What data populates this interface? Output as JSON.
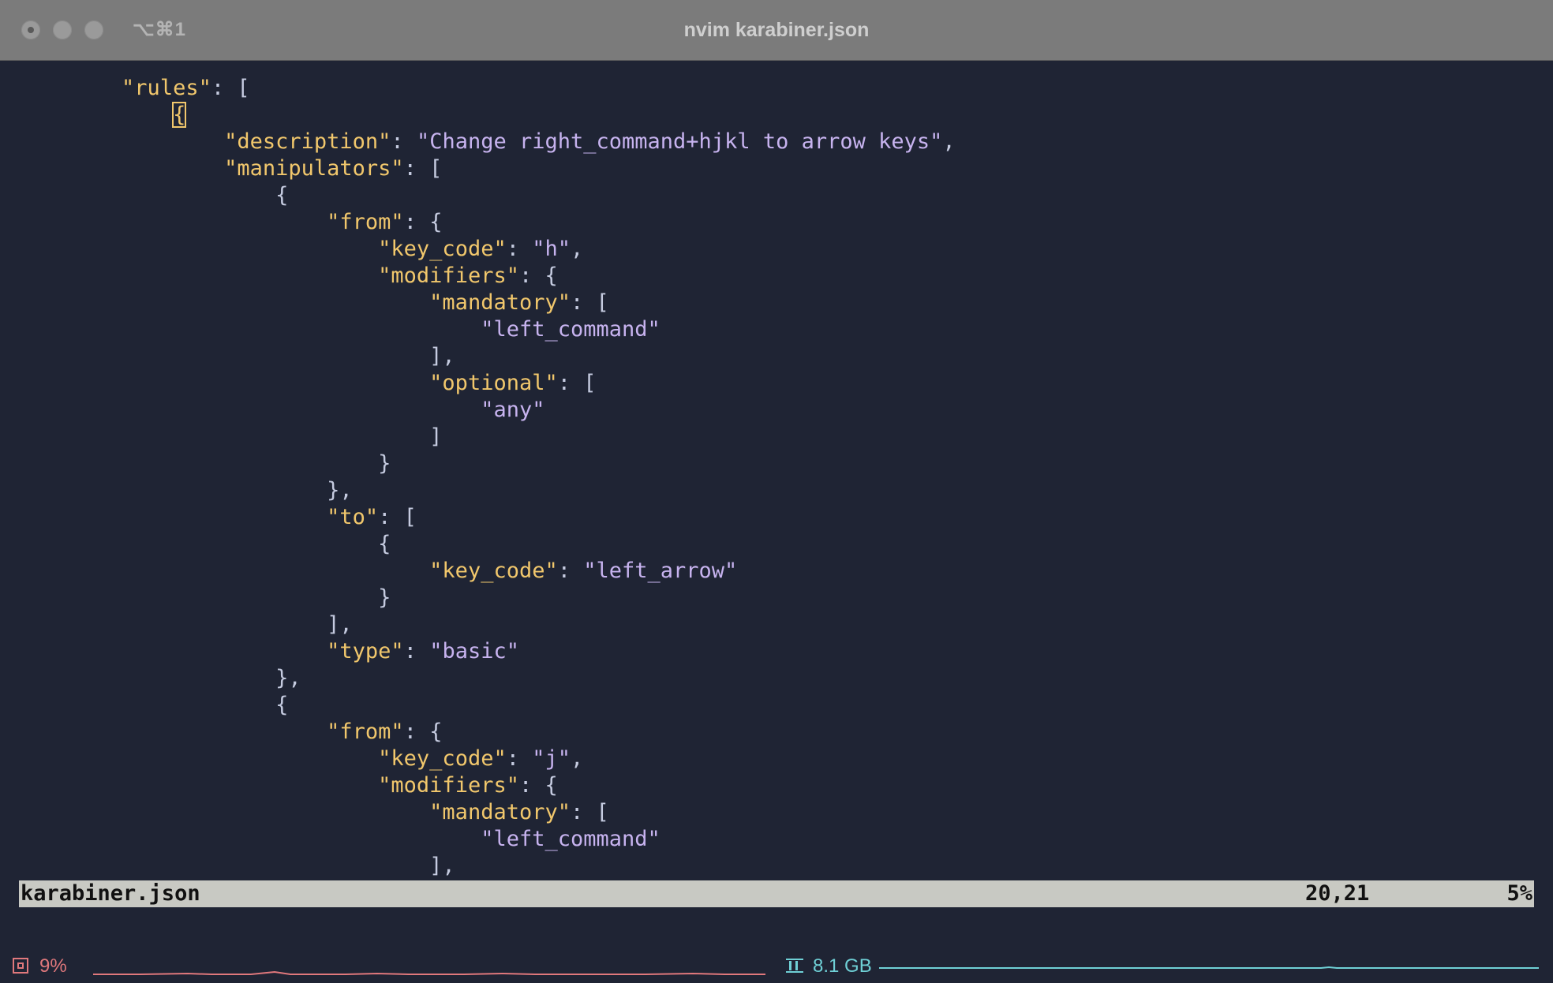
{
  "window": {
    "title": "nvim karabiner.json",
    "shortcut": "⌥⌘1"
  },
  "code_lines": [
    [
      {
        "t": "        ",
        "c": "p"
      },
      {
        "t": "\"rules\"",
        "c": "k"
      },
      {
        "t": ": [",
        "c": "p"
      }
    ],
    [
      {
        "t": "            ",
        "c": "p"
      },
      {
        "t": "{",
        "c": "cursor"
      }
    ],
    [
      {
        "t": "                ",
        "c": "p"
      },
      {
        "t": "\"description\"",
        "c": "k"
      },
      {
        "t": ": ",
        "c": "p"
      },
      {
        "t": "\"Change right_command+hjkl to arrow keys\"",
        "c": "s"
      },
      {
        "t": ",",
        "c": "p"
      }
    ],
    [
      {
        "t": "                ",
        "c": "p"
      },
      {
        "t": "\"manipulators\"",
        "c": "k"
      },
      {
        "t": ": [",
        "c": "p"
      }
    ],
    [
      {
        "t": "                    {",
        "c": "p"
      }
    ],
    [
      {
        "t": "                        ",
        "c": "p"
      },
      {
        "t": "\"from\"",
        "c": "k"
      },
      {
        "t": ": {",
        "c": "p"
      }
    ],
    [
      {
        "t": "                            ",
        "c": "p"
      },
      {
        "t": "\"key_code\"",
        "c": "k"
      },
      {
        "t": ": ",
        "c": "p"
      },
      {
        "t": "\"h\"",
        "c": "s"
      },
      {
        "t": ",",
        "c": "p"
      }
    ],
    [
      {
        "t": "                            ",
        "c": "p"
      },
      {
        "t": "\"modifiers\"",
        "c": "k"
      },
      {
        "t": ": {",
        "c": "p"
      }
    ],
    [
      {
        "t": "                                ",
        "c": "p"
      },
      {
        "t": "\"mandatory\"",
        "c": "k"
      },
      {
        "t": ": [",
        "c": "p"
      }
    ],
    [
      {
        "t": "                                    ",
        "c": "p"
      },
      {
        "t": "\"left_command\"",
        "c": "s"
      }
    ],
    [
      {
        "t": "                                ],",
        "c": "p"
      }
    ],
    [
      {
        "t": "                                ",
        "c": "p"
      },
      {
        "t": "\"optional\"",
        "c": "k"
      },
      {
        "t": ": [",
        "c": "p"
      }
    ],
    [
      {
        "t": "                                    ",
        "c": "p"
      },
      {
        "t": "\"any\"",
        "c": "s"
      }
    ],
    [
      {
        "t": "                                ]",
        "c": "p"
      }
    ],
    [
      {
        "t": "                            }",
        "c": "p"
      }
    ],
    [
      {
        "t": "                        },",
        "c": "p"
      }
    ],
    [
      {
        "t": "                        ",
        "c": "p"
      },
      {
        "t": "\"to\"",
        "c": "k"
      },
      {
        "t": ": [",
        "c": "p"
      }
    ],
    [
      {
        "t": "                            {",
        "c": "p"
      }
    ],
    [
      {
        "t": "                                ",
        "c": "p"
      },
      {
        "t": "\"key_code\"",
        "c": "k"
      },
      {
        "t": ": ",
        "c": "p"
      },
      {
        "t": "\"left_arrow\"",
        "c": "s"
      }
    ],
    [
      {
        "t": "                            }",
        "c": "p"
      }
    ],
    [
      {
        "t": "                        ],",
        "c": "p"
      }
    ],
    [
      {
        "t": "                        ",
        "c": "p"
      },
      {
        "t": "\"type\"",
        "c": "k"
      },
      {
        "t": ": ",
        "c": "p"
      },
      {
        "t": "\"basic\"",
        "c": "s"
      }
    ],
    [
      {
        "t": "                    },",
        "c": "p"
      }
    ],
    [
      {
        "t": "                    {",
        "c": "p"
      }
    ],
    [
      {
        "t": "                        ",
        "c": "p"
      },
      {
        "t": "\"from\"",
        "c": "k"
      },
      {
        "t": ": {",
        "c": "p"
      }
    ],
    [
      {
        "t": "                            ",
        "c": "p"
      },
      {
        "t": "\"key_code\"",
        "c": "k"
      },
      {
        "t": ": ",
        "c": "p"
      },
      {
        "t": "\"j\"",
        "c": "s"
      },
      {
        "t": ",",
        "c": "p"
      }
    ],
    [
      {
        "t": "                            ",
        "c": "p"
      },
      {
        "t": "\"modifiers\"",
        "c": "k"
      },
      {
        "t": ": {",
        "c": "p"
      }
    ],
    [
      {
        "t": "                                ",
        "c": "p"
      },
      {
        "t": "\"mandatory\"",
        "c": "k"
      },
      {
        "t": ": [",
        "c": "p"
      }
    ],
    [
      {
        "t": "                                    ",
        "c": "p"
      },
      {
        "t": "\"left_command\"",
        "c": "s"
      }
    ],
    [
      {
        "t": "                                ],",
        "c": "p"
      }
    ]
  ],
  "statusline": {
    "filename": "karabiner.json",
    "position": "20,21",
    "percent": "5%"
  },
  "stats": {
    "cpu_icon": "cpu-chip-icon",
    "cpu_value": "9%",
    "mem_icon": "memory-icon",
    "mem_value": "8.1 GB"
  },
  "colors": {
    "background": "#1f2434",
    "key": "#f1c76c",
    "string": "#c7b3ef",
    "punct": "#c5cbe0",
    "statusline_bg": "#c8c9c3",
    "cpu": "#e0787c",
    "mem": "#6fd0d6"
  }
}
